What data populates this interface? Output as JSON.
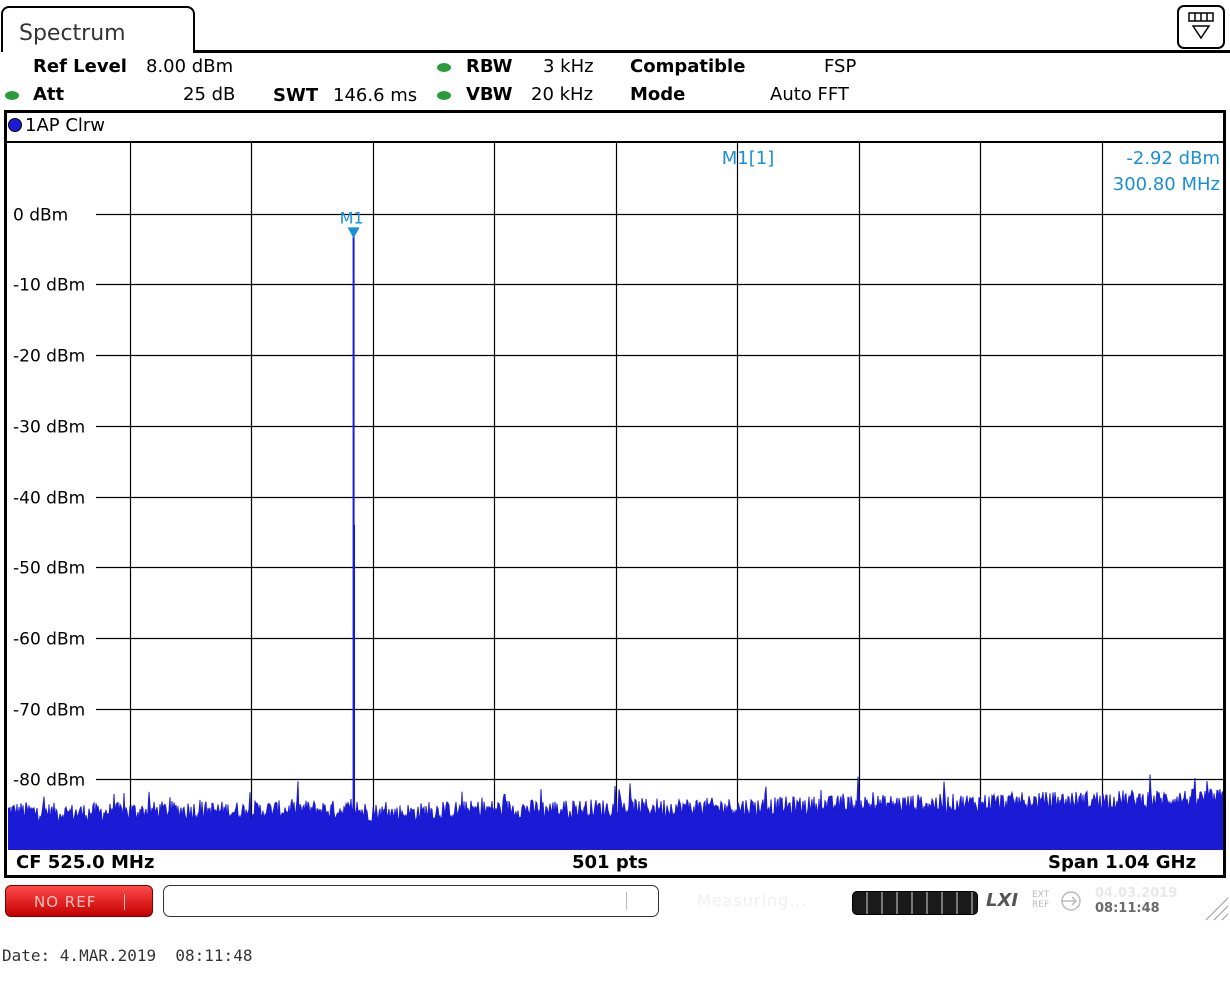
{
  "window": {
    "tab_title": "Spectrum"
  },
  "settings": {
    "ref_level_label": "Ref Level",
    "ref_level_value": "8.00 dBm",
    "att_label": "Att",
    "att_value": "25 dB",
    "swt_label": "SWT",
    "swt_value": "146.6 ms",
    "rbw_label": "RBW",
    "rbw_value": "3 kHz",
    "vbw_label": "VBW",
    "vbw_value": "20 kHz",
    "compatible_label": "Compatible",
    "compatible_value": "FSP",
    "mode_label": "Mode",
    "mode_value": "Auto FFT"
  },
  "trace": {
    "label": "1AP Clrw",
    "color": "#1b1bd6"
  },
  "marker": {
    "name": "M1",
    "readout_name": "M1[1]",
    "level": "-2.92 dBm",
    "freq": "300.80 MHz",
    "color": "#1a8fd6"
  },
  "footer_bar": {
    "cf": "CF 525.0 MHz",
    "pts": "501 pts",
    "span": "Span 1.04 GHz"
  },
  "status": {
    "noref": "NO REF",
    "measuring": "Measuring...",
    "lxi": "LXI",
    "ext_ref_1": "EXT",
    "ext_ref_2": "REF",
    "date": "04.03.2019",
    "time": "08:11:48"
  },
  "printed_date": "Date: 4.MAR.2019  08:11:48",
  "chart_data": {
    "type": "line",
    "xlabel": "",
    "ylabel": "",
    "xlim": [
      5,
      1045
    ],
    "x_unit": "MHz",
    "ylim": [
      -90,
      10
    ],
    "y_unit": "dBm",
    "y_ticks": [
      {
        "value": 0,
        "label": "0 dBm"
      },
      {
        "value": -10,
        "label": "-10 dBm"
      },
      {
        "value": -20,
        "label": "-20 dBm"
      },
      {
        "value": -30,
        "label": "-30 dBm"
      },
      {
        "value": -40,
        "label": "-40 dBm"
      },
      {
        "value": -50,
        "label": "-50 dBm"
      },
      {
        "value": -60,
        "label": "-60 dBm"
      },
      {
        "value": -70,
        "label": "-70 dBm"
      },
      {
        "value": -80,
        "label": "-80 dBm"
      }
    ],
    "grid": true,
    "series": [
      {
        "color": "#1b1bd6",
        "filled": true,
        "noise_floor": [
          [
            5,
            -84.5
          ],
          [
            60,
            -84.8
          ],
          [
            110,
            -84.6
          ],
          [
            160,
            -84.4
          ],
          [
            200,
            -84.5
          ],
          [
            260,
            -84.3
          ],
          [
            300,
            -84.4
          ],
          [
            330,
            -84.9
          ],
          [
            380,
            -84.5
          ],
          [
            430,
            -84.2
          ],
          [
            480,
            -84.3
          ],
          [
            530,
            -84.1
          ],
          [
            580,
            -84.0
          ],
          [
            630,
            -84.0
          ],
          [
            680,
            -83.8
          ],
          [
            730,
            -83.6
          ],
          [
            780,
            -83.5
          ],
          [
            830,
            -83.4
          ],
          [
            880,
            -83.2
          ],
          [
            930,
            -83.0
          ],
          [
            980,
            -82.9
          ],
          [
            1045,
            -82.7
          ]
        ],
        "peaks": [
          {
            "x": 300.8,
            "y": -2.92
          },
          {
            "x": 301.2,
            "y": -44.0
          }
        ]
      }
    ],
    "markers": [
      {
        "name": "M1",
        "x": 300.8,
        "y": -2.92
      }
    ]
  }
}
